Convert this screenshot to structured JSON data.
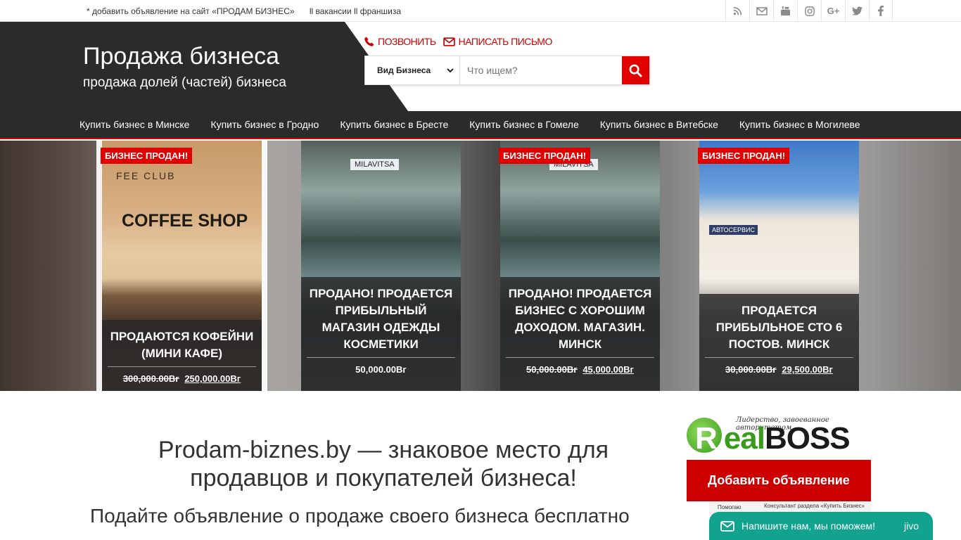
{
  "topbar": {
    "link1": "* добавить объявление на сайт «ПРОДАМ БИЗНЕС»",
    "link2": "ll вакансии ll франшиза"
  },
  "header": {
    "title": "Продажа бизнеса",
    "subtitle": "продажа долей (частей) бизнеса",
    "call_label": "ПОЗВОНИТЬ",
    "mail_label": "НАПИСАТЬ ПИСЬМО",
    "search": {
      "category": "Вид Бизнеса",
      "placeholder": "Что ищем?"
    }
  },
  "nav": [
    "Купить бизнес в Минске",
    "Купить бизнес в Гродно",
    "Купить бизнес в Бресте",
    "Купить бизнес в Гомеле",
    "Купить бизнес в Витебске",
    "Купить бизнес в Могилеве"
  ],
  "slides": [
    {
      "badge": "БИЗНЕС ПРОДАН!",
      "photo_text1": "FEE CLUB",
      "photo_text2": "COFFEE SHOP",
      "title": "ПРОДАЮТСЯ КОФЕЙНИ (МИНИ КАФЕ)",
      "old_price": "300,000.00Вг",
      "price": "250,000.00Вг"
    },
    {
      "badge": "",
      "photo_text1": "MILAVITSA",
      "photo_text2": "",
      "title": "ПРОДАНО! ПРОДАЕТСЯ ПРИБЫЛЬНЫЙ МАГАЗИН ОДЕЖДЫ КОСМЕТИКИ",
      "old_price": "",
      "price": "50,000.00Вг"
    },
    {
      "badge": "БИЗНЕС ПРОДАН!",
      "photo_text1": "MILAVITSA",
      "photo_text2": "",
      "title": "ПРОДАНО! ПРОДАЕТСЯ БИЗНЕС С ХОРОШИМ ДОХОДОМ. МАГАЗИН. МИНСК",
      "old_price": "50,000.00Вг",
      "price": "45,000.00Вг"
    },
    {
      "badge": "БИЗНЕС ПРОДАН!",
      "photo_text1": "АВТОСЕРВИС",
      "photo_text2": "",
      "title": "ПРОДАЕТСЯ ПРИБЫЛЬНОЕ СТО 6 ПОСТОВ. МИНСК",
      "old_price": "30,000.00Вг",
      "price": "29,500.00Вг"
    }
  ],
  "main": {
    "headline": "Prodam-biznes.by — знаковое место для продавцов и покупателей бизнеса!",
    "subheadline": "Подайте объявление о продаже своего бизнеса бесплатно"
  },
  "sidebar": {
    "logo_slogan": "Лидерство, завоеванное авторитетом",
    "logo_first": "R",
    "logo_mid": "eal",
    "logo_last": "BOSS",
    "add_button": "Добавить объявление",
    "mini_left": "Помогаю",
    "mini_right": "Консультант раздела «Купить Бизнес»"
  },
  "chat": {
    "label": "Напишите нам, мы поможем!",
    "brand": "jivo"
  },
  "colors": {
    "accent": "#e00000",
    "dark": "#2b2b2b",
    "chat": "#11a38d"
  }
}
